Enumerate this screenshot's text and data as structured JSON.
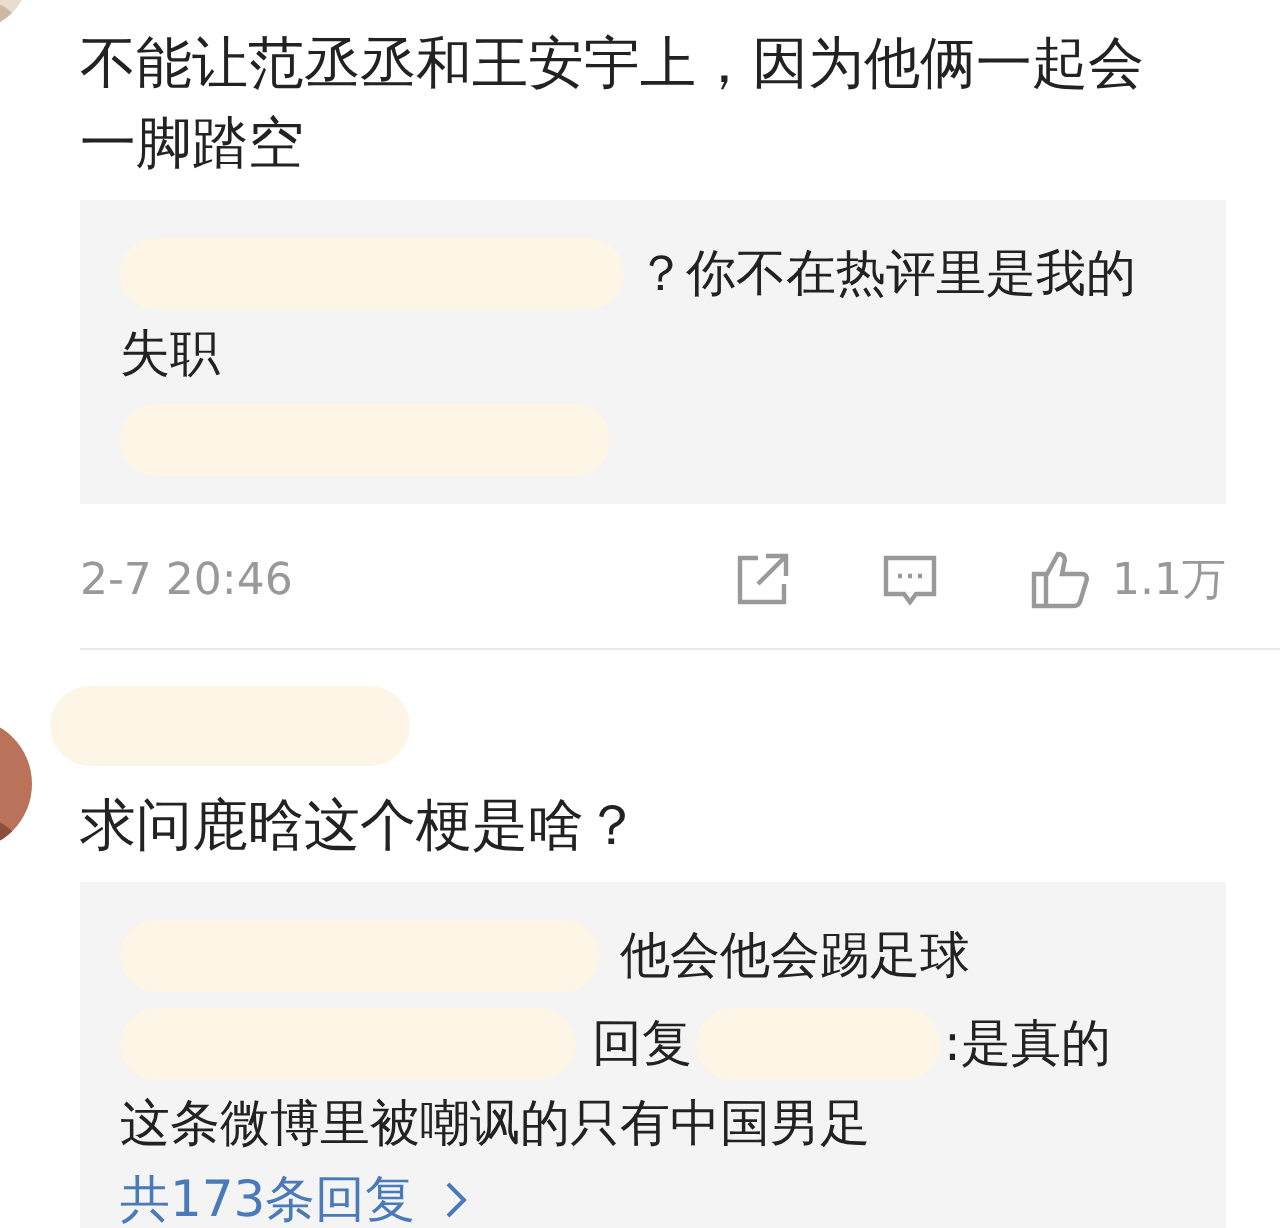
{
  "comments": [
    {
      "text": "不能让范丞丞和王安宇上，因为他俩一起会一脚踏空",
      "reply_box": {
        "replies": [
          {
            "kind": "lead",
            "text": "？你不在热评里是我的",
            "continued": "失职"
          },
          {
            "kind": "hidden"
          }
        ]
      },
      "footer": {
        "time": "2-7 20:46",
        "likes": "1.1万"
      }
    },
    {
      "text": "求问鹿晗这个梗是啥？",
      "reply_box": {
        "replies": [
          {
            "kind": "lead",
            "text": "他会他会踢足球"
          },
          {
            "kind": "reply",
            "prefix": "回复",
            "text": ":是真的",
            "continued": "这条微博里被嘲讽的只有中国男足"
          }
        ],
        "more_link": "共173条回复"
      }
    }
  ]
}
